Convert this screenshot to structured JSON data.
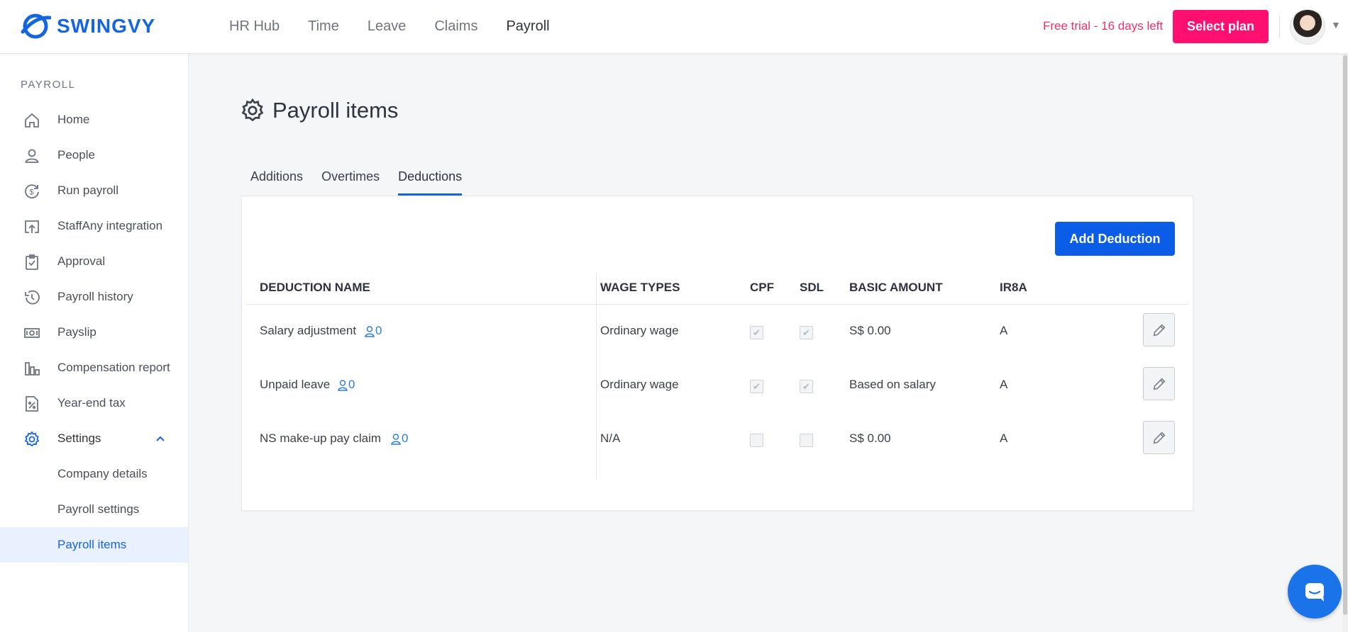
{
  "brand": {
    "name": "SWINGVY",
    "color": "#1565e0"
  },
  "topnav": {
    "items": [
      {
        "label": "HR Hub"
      },
      {
        "label": "Time"
      },
      {
        "label": "Leave"
      },
      {
        "label": "Claims"
      },
      {
        "label": "Payroll",
        "active": true
      }
    ]
  },
  "header": {
    "trial_text": "Free trial - 16 days left",
    "select_plan_label": "Select plan"
  },
  "sidebar": {
    "heading": "PAYROLL",
    "items": [
      {
        "label": "Home",
        "icon": "home-icon"
      },
      {
        "label": "People",
        "icon": "person-icon"
      },
      {
        "label": "Run payroll",
        "icon": "dollar-cycle-icon"
      },
      {
        "label": "StaffAny integration",
        "icon": "upload-icon"
      },
      {
        "label": "Approval",
        "icon": "clipboard-check-icon"
      },
      {
        "label": "Payroll history",
        "icon": "history-icon"
      },
      {
        "label": "Payslip",
        "icon": "money-icon"
      },
      {
        "label": "Compensation report",
        "icon": "bar-chart-icon"
      },
      {
        "label": "Year-end tax",
        "icon": "percent-icon"
      },
      {
        "label": "Settings",
        "icon": "gear-icon",
        "expanded": true
      }
    ],
    "sub_items": [
      {
        "label": "Company details"
      },
      {
        "label": "Payroll settings"
      },
      {
        "label": "Payroll items",
        "active": true
      }
    ]
  },
  "page": {
    "title": "Payroll items",
    "tabs": [
      {
        "label": "Additions"
      },
      {
        "label": "Overtimes"
      },
      {
        "label": "Deductions",
        "active": true
      }
    ],
    "add_button_label": "Add Deduction"
  },
  "table": {
    "columns": [
      "DEDUCTION NAME",
      "WAGE TYPES",
      "CPF",
      "SDL",
      "BASIC AMOUNT",
      "IR8A"
    ],
    "rows": [
      {
        "name": "Salary adjustment",
        "count": "0",
        "wage_type": "Ordinary wage",
        "cpf": true,
        "sdl": true,
        "basic_amount": "S$ 0.00",
        "ir8a": "A"
      },
      {
        "name": "Unpaid leave",
        "count": "0",
        "wage_type": "Ordinary wage",
        "cpf": true,
        "sdl": true,
        "basic_amount": "Based on salary",
        "ir8a": "A"
      },
      {
        "name": "NS make-up pay claim",
        "count": "0",
        "wage_type": "N/A",
        "cpf": false,
        "sdl": false,
        "basic_amount": "S$ 0.00",
        "ir8a": "A"
      }
    ]
  },
  "colors": {
    "accent": "#1565e0",
    "primary_button": "#0b5ce6",
    "plan_button": "#ff0f6f",
    "trial_text": "#f0306a"
  }
}
